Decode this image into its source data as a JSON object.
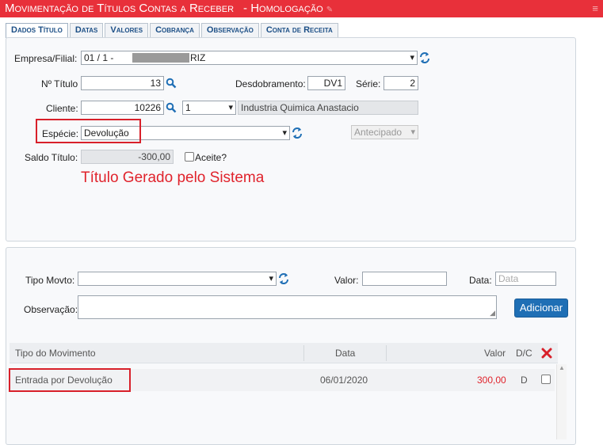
{
  "header": {
    "title": "Movimentação de Títulos Contas a Receber",
    "environment": "- Homologação"
  },
  "tabs": [
    {
      "label": "Dados Título",
      "active": true
    },
    {
      "label": "Datas"
    },
    {
      "label": "Valores"
    },
    {
      "label": "Cobrança"
    },
    {
      "label": "Observação"
    },
    {
      "label": "Conta de Receita"
    }
  ],
  "form": {
    "empresa_label": "Empresa/Filial:",
    "empresa_prefix": "01 / 1 -",
    "empresa_suffix": "RIZ",
    "titulo_label": "Nº Título",
    "titulo_value": "13",
    "desdobramento_label": "Desdobramento:",
    "desdobramento_value": "DV1",
    "serie_label": "Série:",
    "serie_value": "2",
    "cliente_label": "Cliente:",
    "cliente_code": "10226",
    "cliente_select": "1",
    "cliente_name": "Industria Quimica Anastacio",
    "especie_label": "Espécie:",
    "especie_value": "Devolução",
    "antecipado_value": "Antecipado",
    "saldo_label": "Saldo Título:",
    "saldo_value": "-300,00",
    "aceite_label": "Aceite?"
  },
  "annotation": {
    "text": "Título Gerado pelo Sistema",
    "color": "#e0232c"
  },
  "movement": {
    "tipo_label": "Tipo Movto:",
    "tipo_value": "",
    "valor_label": "Valor:",
    "valor_value": "",
    "data_label": "Data:",
    "data_placeholder": "Data",
    "observacao_label": "Observação:",
    "add_button": "Adicionar"
  },
  "grid": {
    "columns": {
      "tipo": "Tipo do Movimento",
      "data": "Data",
      "valor": "Valor",
      "dc": "D/C"
    },
    "rows": [
      {
        "tipo": "Entrada por Devolução",
        "data": "06/01/2020",
        "valor": "300,00",
        "dc": "D"
      }
    ]
  },
  "colors": {
    "title_bar": "#e8303a",
    "accent": "#1f6fb5",
    "highlight_box": "#d8202a",
    "negative_value": "#e0232c"
  }
}
